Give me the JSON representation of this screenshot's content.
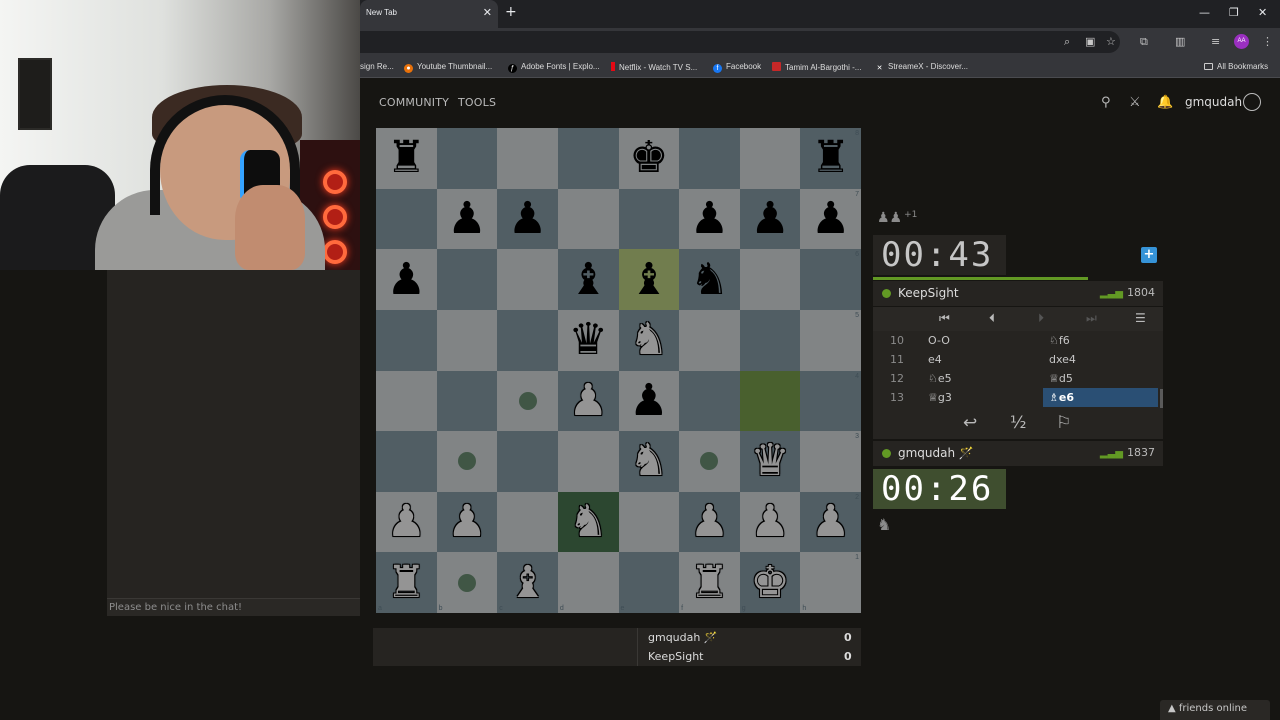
{
  "browser": {
    "tab_title": "New Tab",
    "bookmarks": [
      {
        "label": "sign Re..."
      },
      {
        "label": "Youtube Thumbnail..."
      },
      {
        "label": "Adobe Fonts | Explo..."
      },
      {
        "label": "Netflix - Watch TV S..."
      },
      {
        "label": "Facebook"
      },
      {
        "label": "Tamim Al-Bargothi -..."
      },
      {
        "label": "StreameX - Discover..."
      }
    ],
    "all_bookmarks": "All Bookmarks",
    "profile_initials": "AA"
  },
  "site": {
    "nav": [
      "COMMUNITY",
      "TOOLS"
    ],
    "username": "gmqudah"
  },
  "chat": {
    "placeholder": "Please be nice in the chat!"
  },
  "board": {
    "ranks": [
      "8",
      "7",
      "6",
      "5",
      "4",
      "3",
      "2",
      "1"
    ],
    "files": [
      "a",
      "b",
      "c",
      "d",
      "e",
      "f",
      "g",
      "h"
    ],
    "position": [
      [
        "bR",
        "",
        "",
        "",
        "bK",
        "",
        "",
        "bR"
      ],
      [
        "",
        "bP",
        "bP",
        "",
        "",
        "bP",
        "bP",
        "bP"
      ],
      [
        "bP",
        "",
        "",
        "bB",
        "bB",
        "bN",
        "",
        ""
      ],
      [
        "",
        "",
        "",
        "bQ",
        "wN",
        "",
        "",
        ""
      ],
      [
        "",
        "",
        "dot",
        "wP",
        "bP",
        "",
        "hl",
        ""
      ],
      [
        "",
        "dot",
        "",
        "",
        "wN",
        "dot",
        "wQ",
        ""
      ],
      [
        "wP",
        "wP",
        "",
        "wN",
        "",
        "wP",
        "wP",
        "wP"
      ],
      [
        "wR",
        "dot",
        "wB",
        "",
        "",
        "wR",
        "wK",
        ""
      ]
    ]
  },
  "game": {
    "captured_top": "♟♟",
    "captured_top_plus": "+1",
    "clock_top": "00:43",
    "clock_bottom": "00:26",
    "clock_top_progress": 0.74,
    "opponent": {
      "name": "KeepSight",
      "rating": "1804"
    },
    "player": {
      "name": "gmqudah 🪄",
      "rating": "1837"
    },
    "moves": [
      {
        "n": "10",
        "w": "O-O",
        "b": "♘f6"
      },
      {
        "n": "11",
        "w": "e4",
        "b": "dxe4"
      },
      {
        "n": "12",
        "w": "♘e5",
        "b": "♕d5"
      },
      {
        "n": "13",
        "w": "♕g3",
        "b": "♗e6"
      }
    ],
    "draw_label": "½",
    "captured_bottom": "♞"
  },
  "crosstable": [
    {
      "name": "gmqudah 🪄",
      "score": "0"
    },
    {
      "name": "KeepSight",
      "score": "0"
    }
  ],
  "friends": "▲ friends online",
  "colors": {
    "board_light": "#dee3e6",
    "board_dark": "#8ca2ad",
    "highlight": "#c3d887",
    "accent_green": "#629924",
    "active_move": "#2a4f74"
  }
}
